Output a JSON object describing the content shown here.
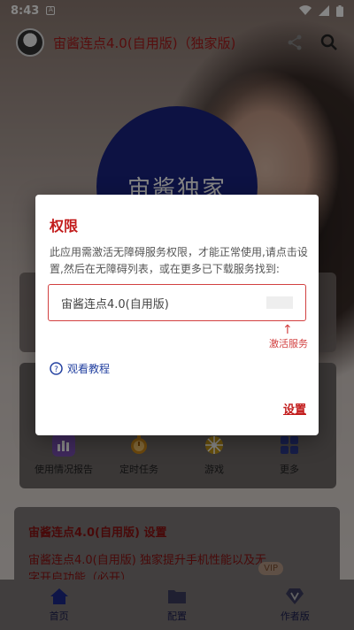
{
  "status_bar": {
    "time": "8:43",
    "small_icon": "A"
  },
  "header": {
    "title": "宙酱连点4.0(自用版)（独家版)"
  },
  "hero": {
    "circle_text": "宙酱独家"
  },
  "dialog": {
    "title": "权限",
    "message": "此应用需激活无障碍服务权限，才能正常使用,请点击设置,然后在无障碍列表，或在更多已下载服务找到:",
    "service_name": "宙酱连点4.0(自用版)",
    "activate_label": "激活服务",
    "tutorial_label": "观看教程",
    "settings_label": "设置"
  },
  "quick_actions": [
    {
      "label": "使用情况报告",
      "icon": "chart-icon",
      "color": "#7a4fb0"
    },
    {
      "label": "定时任务",
      "icon": "timer-icon",
      "color": "#d08a1a"
    },
    {
      "label": "游戏",
      "icon": "game-icon",
      "color": "#c79a1a"
    },
    {
      "label": "更多",
      "icon": "grid-icon",
      "color": "#2c3a8c"
    }
  ],
  "settings_card": {
    "title": "宙酱连点4.0(自用版) 设置",
    "text": "宙酱连点4.0(自用版) 独家提升手机性能以及无字开启功能（必开）",
    "badge": "VIP"
  },
  "bottom_nav": [
    {
      "label": "首页",
      "icon": "home-icon"
    },
    {
      "label": "配置",
      "icon": "folder-icon"
    },
    {
      "label": "作者版",
      "icon": "diamond-v-icon"
    }
  ],
  "colors": {
    "accent_red": "#c21b1b",
    "circle_blue": "#1a2380",
    "nav_blue": "#2c3a8c"
  }
}
